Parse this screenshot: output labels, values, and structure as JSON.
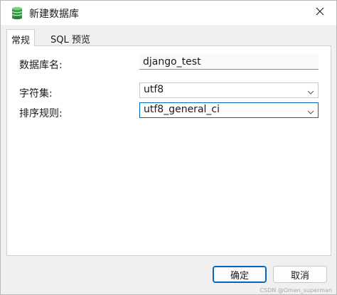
{
  "window": {
    "title": "新建数据库",
    "app_icon": "database-icon",
    "close_icon": "close-icon"
  },
  "tabs": [
    {
      "label": "常规",
      "active": true
    },
    {
      "label": "SQL 预览",
      "active": false
    }
  ],
  "form": {
    "database_name_label": "数据库名:",
    "database_name_value": "django_test",
    "charset_label": "字符集:",
    "charset_value": "utf8",
    "collation_label": "排序规则:",
    "collation_value": "utf8_general_ci"
  },
  "buttons": {
    "ok_label": "确定",
    "cancel_label": "取消"
  },
  "watermark": "CSDN @Omen_superman",
  "colors": {
    "accent": "#0067c0",
    "db_icon": "#3c9a46"
  }
}
